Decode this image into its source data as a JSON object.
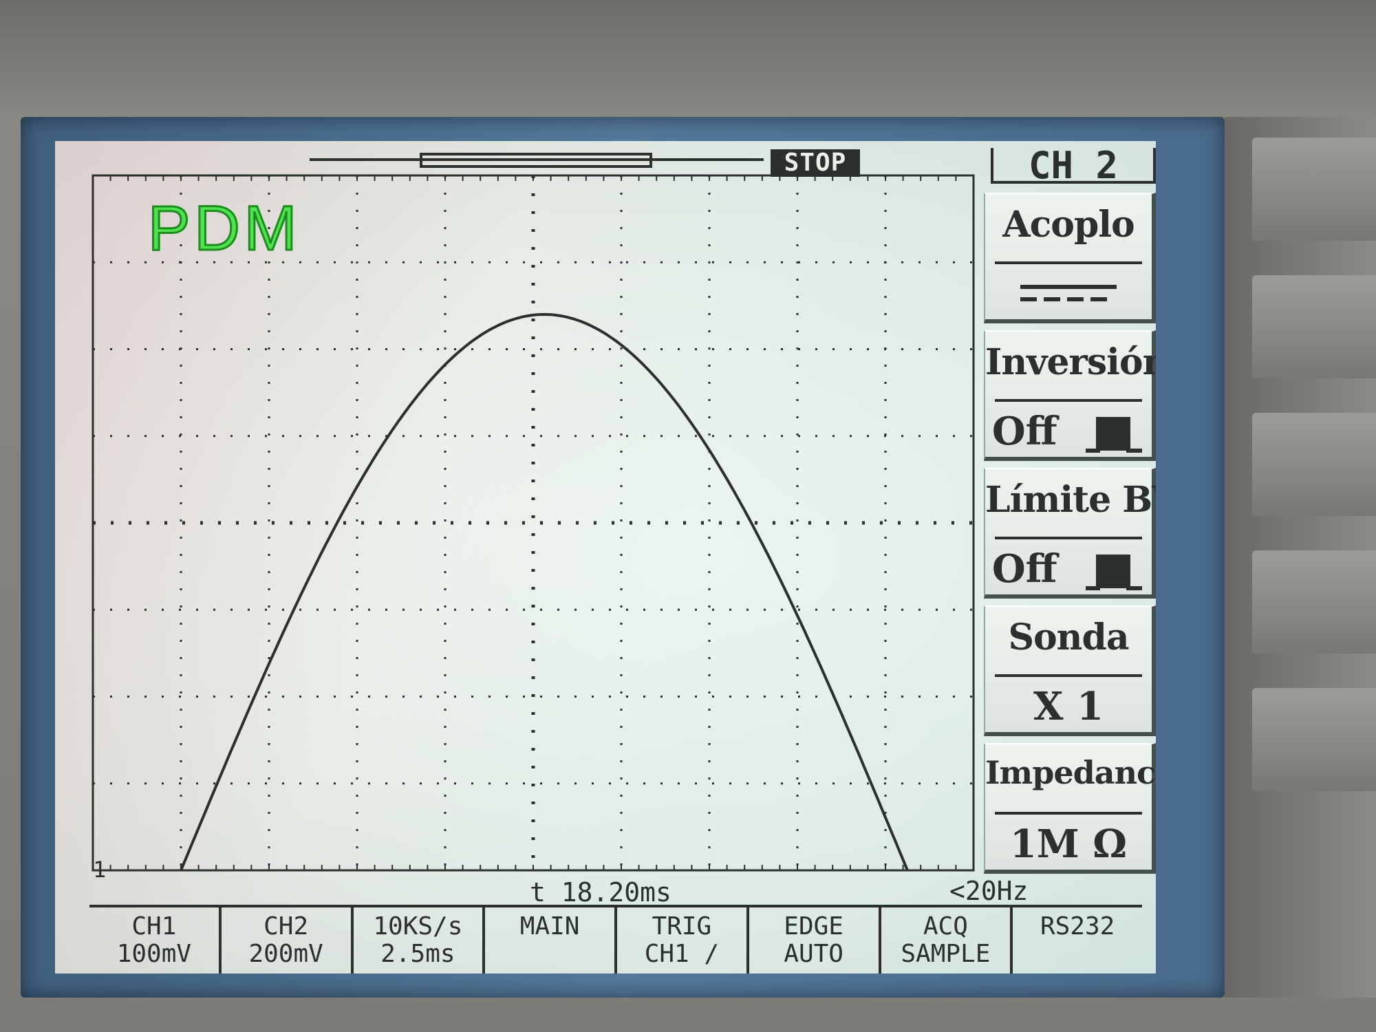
{
  "overlay": {
    "label": "PDM"
  },
  "status": {
    "run_state": "STOP"
  },
  "markers": {
    "channel": "1",
    "time": "t 18.20ms",
    "frequency": "<20Hz"
  },
  "menu": {
    "title": "CH 2",
    "items": [
      {
        "label": "Acoplo",
        "value": "",
        "icon": "dc-coupling-icon"
      },
      {
        "label": "Inversión",
        "value": "Off",
        "icon": "pulse-icon"
      },
      {
        "label": "Límite BW",
        "value": "Off",
        "icon": "pulse-icon"
      },
      {
        "label": "Sonda",
        "value": "X 1"
      },
      {
        "label": "Impedancia",
        "value": "1M Ω"
      }
    ]
  },
  "bottom_bar": [
    {
      "line1": "CH1",
      "line2": "100mV",
      "icon": "dc-coupling-icon"
    },
    {
      "line1": "CH2",
      "line2": "200mV",
      "icon": "dc-coupling-icon"
    },
    {
      "line1": "10KS/s",
      "line2": "2.5ms"
    },
    {
      "line1": "MAIN",
      "line2": ""
    },
    {
      "line1": "TRIG",
      "line2": "CH1 /",
      "icon": "dc-coupling-icon"
    },
    {
      "line1": "EDGE",
      "line2": "AUTO"
    },
    {
      "line1": "ACQ",
      "line2": "SAMPLE"
    },
    {
      "line1": "RS232",
      "line2": ""
    }
  ],
  "colors": {
    "trace": "#2b302d",
    "screen": "#eaf0ea",
    "overlay_label": "#4fe14f",
    "bezel": "#4a6b8c"
  },
  "waveform": {
    "shape": "half-sine",
    "start_fraction": 0.1,
    "end_fraction": 0.925,
    "peak_fraction_of_screen_height": 0.8
  }
}
